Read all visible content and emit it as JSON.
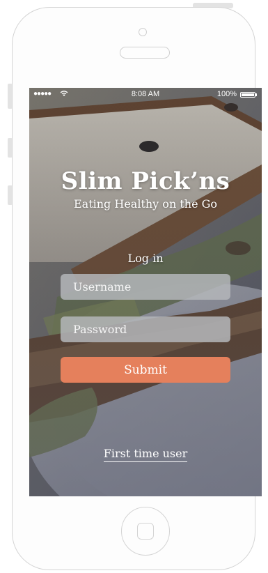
{
  "status_bar": {
    "signal": "●●●●●",
    "wifi_icon": "wifi-icon",
    "time": "8:08 AM",
    "battery": "100%"
  },
  "app": {
    "title": "Slim Pick’ns",
    "tagline": "Eating Healthy on the Go"
  },
  "login": {
    "label": "Log in",
    "username_placeholder": "Username",
    "password_placeholder": "Password",
    "submit_label": "Submit",
    "first_time_label": "First time user"
  },
  "colors": {
    "accent": "#e5805c",
    "field_bg": "#b4b6ba"
  }
}
